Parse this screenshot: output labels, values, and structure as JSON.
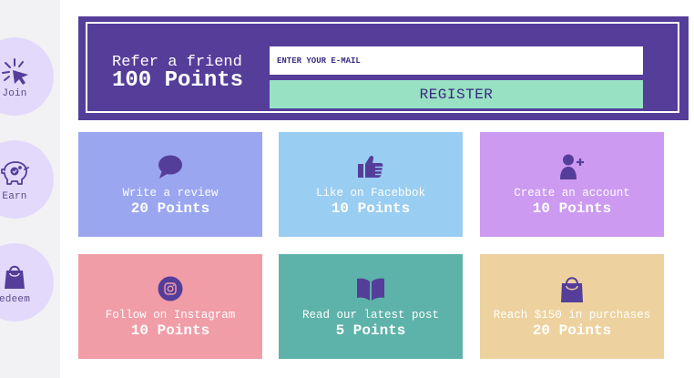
{
  "sidebar": {
    "items": [
      {
        "label": "Join",
        "icon": "cursor-click-icon"
      },
      {
        "label": "Earn",
        "icon": "piggy-bank-icon"
      },
      {
        "label": "edeem",
        "icon": "shopping-bag-icon"
      }
    ]
  },
  "referral": {
    "title": "Refer a friend",
    "points": "100 Points",
    "email_placeholder": "ENTER YOUR E-MAIL",
    "register_label": "REGISTER"
  },
  "cards": [
    {
      "title": "Write a review",
      "points": "20 Points",
      "icon": "speech-bubble-icon",
      "color": "#9aa6ef"
    },
    {
      "title": "Like on Facebbok",
      "points": "10 Points",
      "icon": "thumbs-up-icon",
      "color": "#99cdf1"
    },
    {
      "title": "Create an account",
      "points": "10 Points",
      "icon": "add-user-icon",
      "color": "#cc9af0"
    },
    {
      "title": "Follow on Instagram",
      "points": "10 Points",
      "icon": "instagram-icon",
      "color": "#f09da8"
    },
    {
      "title": "Read our latest post",
      "points": "5 Points",
      "icon": "open-book-icon",
      "color": "#5db3aa"
    },
    {
      "title": "Reach $150 in purchases",
      "points": "20 Points",
      "icon": "shopping-bag-icon",
      "color": "#edd29f"
    }
  ],
  "colors": {
    "accent": "#553d9a",
    "register_button": "#98e1c3",
    "sidebar_circle": "#e3dafb"
  }
}
